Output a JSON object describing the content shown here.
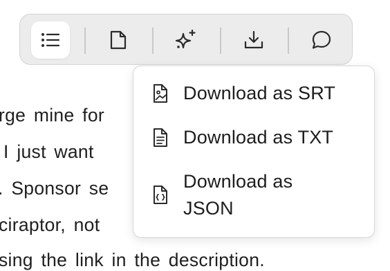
{
  "background_text": {
    "lines": [
      "rge mine for",
      "I just want",
      ". Sponsor se",
      "ciraptor, not",
      "sing the link in the description."
    ]
  },
  "toolbar": {
    "buttons": [
      {
        "icon": "list-icon",
        "active": true
      },
      {
        "icon": "page-icon",
        "active": false
      },
      {
        "icon": "sparkles-icon",
        "active": false
      },
      {
        "icon": "download-icon",
        "active": false
      },
      {
        "icon": "comment-icon",
        "active": false
      }
    ]
  },
  "download_menu": {
    "items": [
      {
        "label": "Download as SRT",
        "icon": "image-file-icon"
      },
      {
        "label": "Download as TXT",
        "icon": "text-file-icon"
      },
      {
        "label": "Download as JSON",
        "icon": "code-file-icon"
      }
    ]
  },
  "colors": {
    "toolbar_bg": "#ececec",
    "active_button_bg": "#ffffff",
    "text": "#1f1f1f",
    "icon_stroke": "#2a2a2a"
  }
}
